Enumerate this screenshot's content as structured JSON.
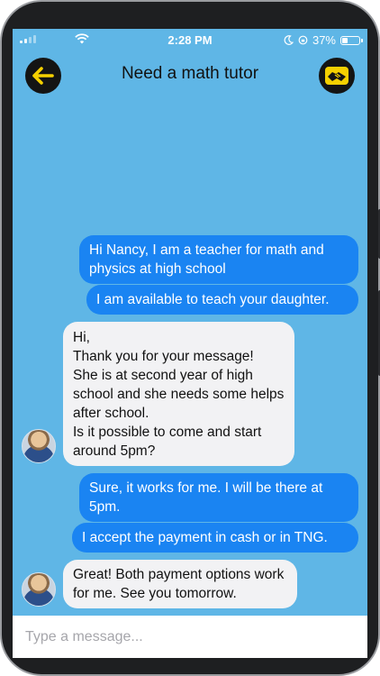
{
  "status_bar": {
    "time": "2:28 PM",
    "battery_text": "37%",
    "battery_level": 0.37,
    "icons": [
      "signal-icon",
      "wifi-icon",
      "moon-icon",
      "lock-rotation-icon",
      "battery-icon"
    ]
  },
  "header": {
    "title": "Need a math tutor",
    "back_icon": "back-arrow-icon",
    "action_icon": "handshake-icon",
    "accent_color": "#f5d000"
  },
  "messages": [
    {
      "side": "out",
      "text": "Hi Nancy, I am a teacher for math and physics at high school"
    },
    {
      "side": "out",
      "text": "I am available to teach your daughter."
    },
    {
      "side": "in",
      "text": "Hi,\nThank you for your message!\nShe is at second year of high school and she needs some helps after school.\nIs it possible to come and start around 5pm?"
    },
    {
      "side": "out",
      "text": "Sure, it works for me. I will be there at 5pm."
    },
    {
      "side": "out",
      "text": "I accept the payment in cash or in TNG."
    },
    {
      "side": "in",
      "text": "Great! Both payment options work for me. See you tomorrow."
    }
  ],
  "composer": {
    "placeholder": "Type a message..."
  },
  "colors": {
    "background": "#5fb6e6",
    "outgoing_bubble": "#1a84f2",
    "incoming_bubble": "#f2f2f4"
  }
}
